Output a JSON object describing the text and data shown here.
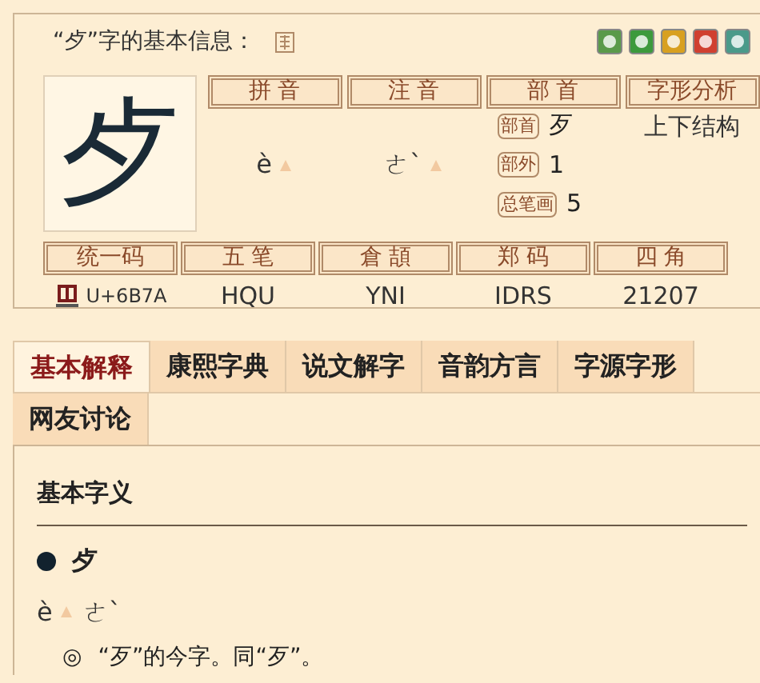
{
  "title": "“歺”字的基本信息：",
  "character": "歺",
  "info_row1": [
    {
      "heading": "拼 音",
      "kind": "sound",
      "value": "è"
    },
    {
      "heading": "注 音",
      "kind": "sound",
      "value": "ㄜˋ"
    },
    {
      "heading": "部 首",
      "kind": "radical",
      "entries": [
        {
          "label": "部首",
          "value": "歹"
        },
        {
          "label": "部外",
          "value": "1"
        },
        {
          "label": "总笔画",
          "value": "5"
        }
      ]
    },
    {
      "heading": "字形分析",
      "kind": "plain",
      "value": "上下结构"
    }
  ],
  "info_row2": [
    {
      "heading": "统一码",
      "kind": "unicode",
      "value": "U+6B7A"
    },
    {
      "heading": "五 笔",
      "kind": "plain",
      "value": "HQU"
    },
    {
      "heading": "倉 頡",
      "kind": "plain",
      "value": "YNI"
    },
    {
      "heading": "郑 码",
      "kind": "plain",
      "value": "IDRS"
    },
    {
      "heading": "四 角",
      "kind": "plain",
      "value": "21207"
    }
  ],
  "tabs": [
    {
      "label": "基本解释",
      "selected": true
    },
    {
      "label": "康熙字典",
      "selected": false
    },
    {
      "label": "说文解字",
      "selected": false
    },
    {
      "label": "音韵方言",
      "selected": false
    },
    {
      "label": "字源字形",
      "selected": false
    },
    {
      "label": "网友讨论",
      "selected": false
    }
  ],
  "section": {
    "heading": "基本字义",
    "character": "歺",
    "pinyin": "è",
    "zhuyin": "ㄜˋ",
    "definitions": [
      {
        "marker": "◎",
        "text": "“歹”的今字。同“歹”。"
      }
    ]
  }
}
